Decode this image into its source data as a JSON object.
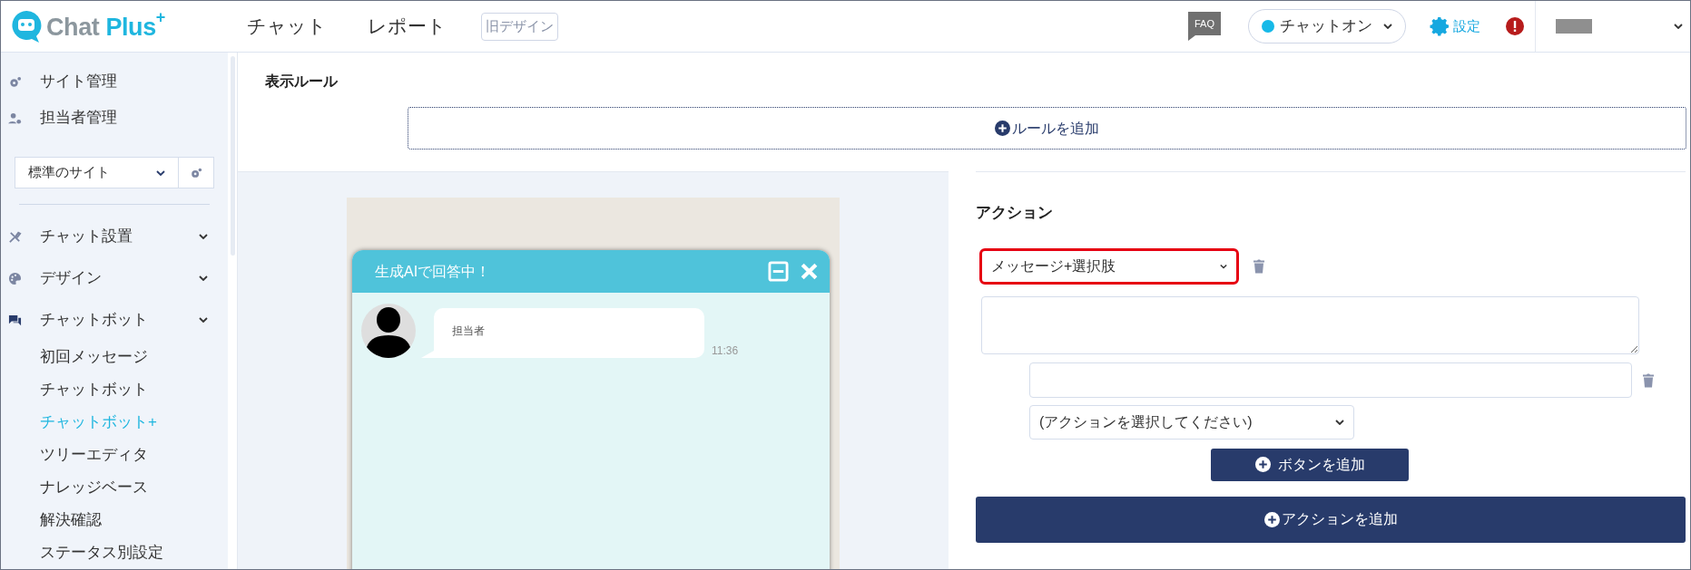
{
  "header": {
    "logo": {
      "word1": "Chat",
      "word2": "Plus",
      "mark": "+"
    },
    "nav": [
      "チャット",
      "レポート"
    ],
    "legacy_button": "旧デザイン",
    "faq": "FAQ",
    "status": {
      "label": "チャットオン",
      "on": true
    },
    "settings": "設定"
  },
  "sidebar": {
    "top_items": [
      {
        "kind": "gear",
        "label": "サイト管理"
      },
      {
        "kind": "person",
        "label": "担当者管理"
      }
    ],
    "site_select": {
      "value": "標準のサイト"
    },
    "menu": [
      {
        "kind": "tools",
        "label": "チャット設置"
      },
      {
        "kind": "palette",
        "label": "デザイン"
      },
      {
        "kind": "chat",
        "label": "チャットボット",
        "children": [
          {
            "label": "初回メッセージ",
            "selected": false
          },
          {
            "label": "チャットボット",
            "selected": false
          },
          {
            "label": "チャットボット+",
            "selected": true
          },
          {
            "label": "ツリーエディタ",
            "selected": false
          },
          {
            "label": "ナレッジベース",
            "selected": false
          },
          {
            "label": "解決確認",
            "selected": false
          },
          {
            "label": "ステータス別設定",
            "selected": false
          }
        ]
      }
    ]
  },
  "rules": {
    "title": "表示ルール",
    "add_button": "ルールを追加"
  },
  "preview": {
    "title": "生成AIで回答中！",
    "sender": "担当者",
    "time": "11:36"
  },
  "action": {
    "title": "アクション",
    "type_select": {
      "value": "メッセージ+選択肢",
      "highlighted": true
    },
    "choice_select": {
      "value": "(アクションを選択してください)"
    },
    "add_choice_button": "ボタンを追加",
    "add_action_button": "アクションを追加"
  }
}
